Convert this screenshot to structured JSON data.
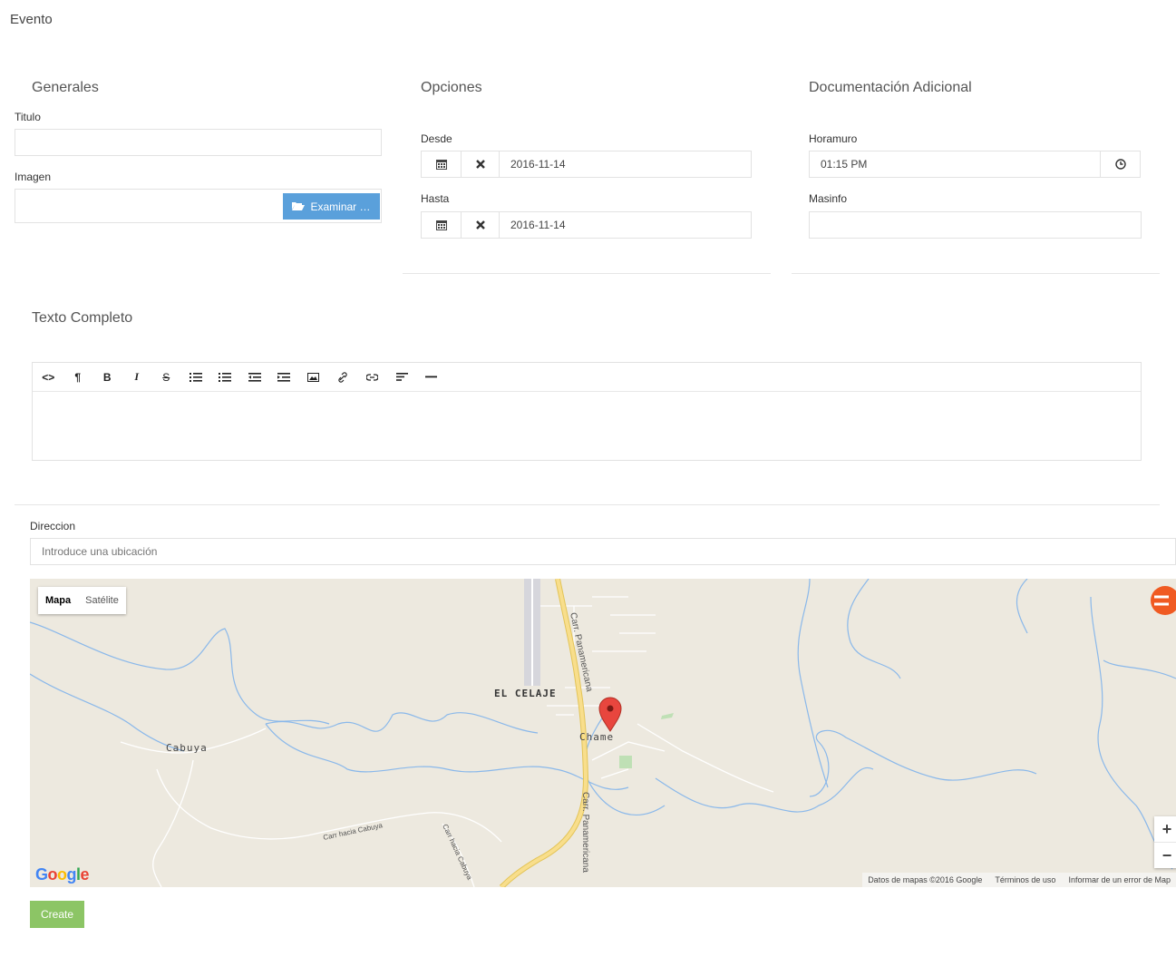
{
  "page": {
    "title": "Evento"
  },
  "generales": {
    "title": "Generales",
    "titulo_label": "Titulo",
    "titulo_value": "",
    "imagen_label": "Imagen",
    "examinar_label": "Examinar …"
  },
  "opciones": {
    "title": "Opciones",
    "desde_label": "Desde",
    "desde_value": "2016-11-14",
    "hasta_label": "Hasta",
    "hasta_value": "2016-11-14"
  },
  "documentacion": {
    "title": "Documentación Adicional",
    "horamuro_label": "Horamuro",
    "horamuro_value": "01:15 PM",
    "masinfo_label": "Masinfo",
    "masinfo_value": ""
  },
  "texto": {
    "title": "Texto Completo",
    "toolbar": [
      "<>",
      "¶",
      "B",
      "I",
      "S",
      "ul",
      "ol",
      "outdent",
      "indent",
      "image",
      "link",
      "unlink",
      "align",
      "hr"
    ],
    "value": ""
  },
  "direccion": {
    "label": "Direccion",
    "placeholder": "Introduce una ubicación"
  },
  "map": {
    "type_map": "Mapa",
    "type_satellite": "Satélite",
    "places": [
      "EL CELAJE",
      "Chame",
      "Cabuya"
    ],
    "roads": [
      "Carr. Panamericana",
      "Carr. Panamericana",
      "Carr hacia Cabuya",
      "Carr hacia Cabuya"
    ],
    "logo": "Google",
    "attribution": [
      "Datos de mapas ©2016 Google",
      "Términos de uso",
      "Informar de un error de Map"
    ],
    "zoom_in": "+",
    "zoom_out": "−",
    "colors": {
      "land": "#ede9df",
      "water": "#7fb2e8",
      "highway": "#f5d77a"
    }
  },
  "actions": {
    "create_label": "Create"
  }
}
